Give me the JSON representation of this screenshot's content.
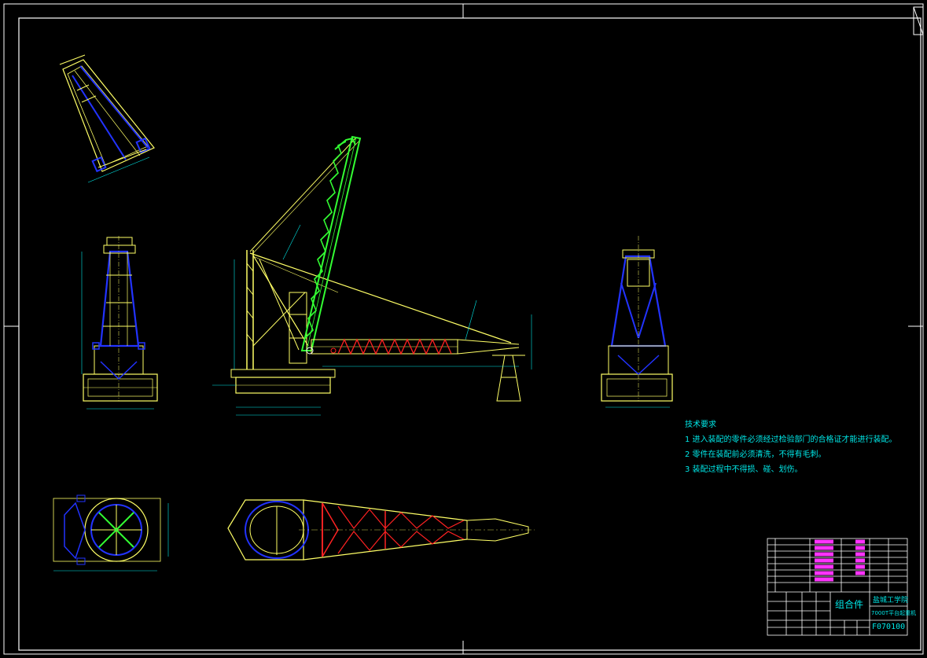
{
  "technical_requirements": {
    "heading": "技术要求",
    "items": [
      "1 进入装配的零件必须经过检验部门的合格证才能进行装配。",
      "2 零件在装配前必须清洗，不得有毛刺。",
      "3 装配过程中不得损、碰、划伤。"
    ]
  },
  "title_block": {
    "assembly_label": "组合件",
    "school": "盐城工学院",
    "drawing_title": "7000T平台起重机",
    "drawing_number": "F070100"
  },
  "colors": {
    "frame": "#ffffff",
    "structure_yellow": "#ffff66",
    "structure_blue": "#2233ff",
    "boom_green": "#33ff33",
    "members_red": "#ff2222",
    "dim_cyan": "#00e6e6",
    "hatch_magenta": "#ff33ff"
  }
}
